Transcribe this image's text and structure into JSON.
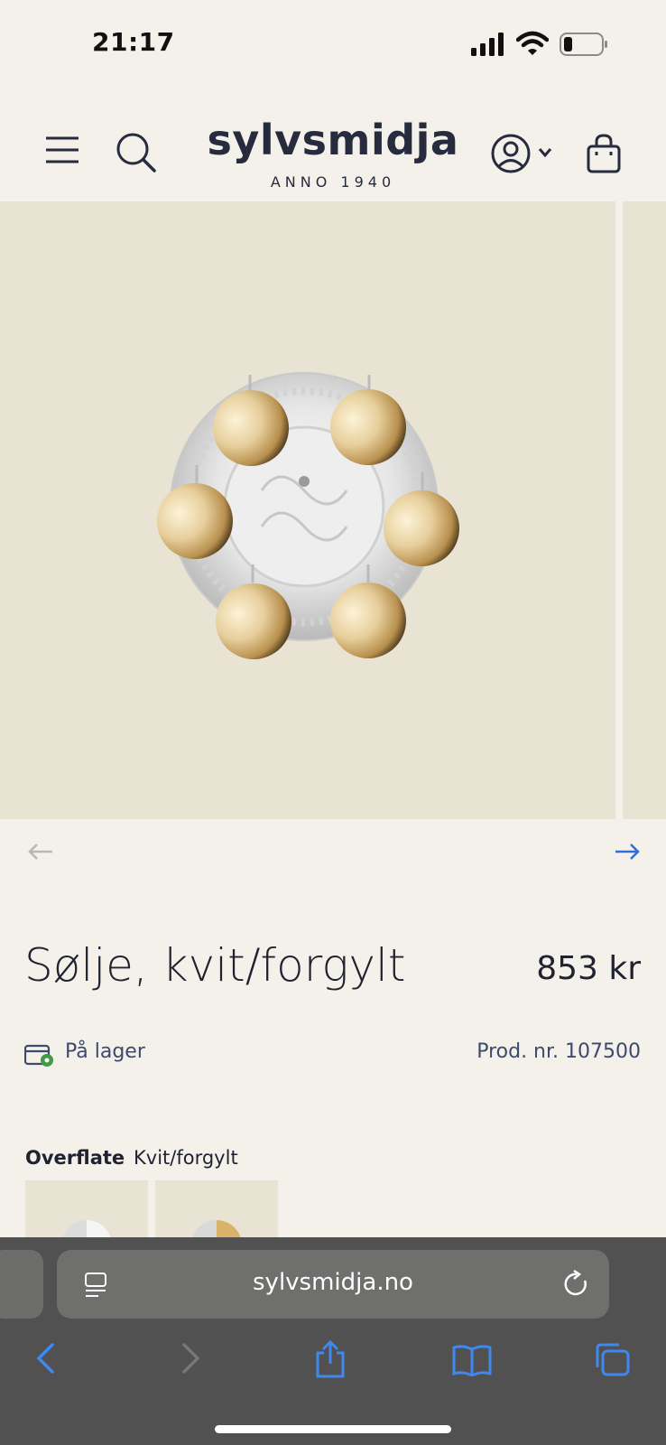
{
  "status_bar": {
    "time": "21:17"
  },
  "header": {
    "logo": "sylvsmidja",
    "logo_sub": "ANNO 1940"
  },
  "product": {
    "title": "Sølje, kvit/forgylt",
    "price": "853 kr",
    "stock": "På lager",
    "prod_nr": "Prod. nr. 107500",
    "option_label": "Overflate",
    "option_value": "Kvit/forgylt"
  },
  "browser": {
    "url": "sylvsmidja.no"
  },
  "colors": {
    "background": "#f4f1ea",
    "image_bg": "#e9e3d3",
    "accent": "#2f6fd6",
    "text": "#1f2230",
    "stock_green": "#3f9b46",
    "toolbar": "#515151"
  },
  "icons": [
    "signal-icon",
    "wifi-icon",
    "battery-icon",
    "menu-icon",
    "search-icon",
    "account-icon",
    "chevron-down-icon",
    "bag-icon",
    "arrow-left-icon",
    "arrow-right-icon",
    "stock-icon",
    "reader-icon",
    "reload-icon",
    "back-icon",
    "forward-icon",
    "share-icon",
    "bookmarks-icon",
    "tabs-icon"
  ]
}
